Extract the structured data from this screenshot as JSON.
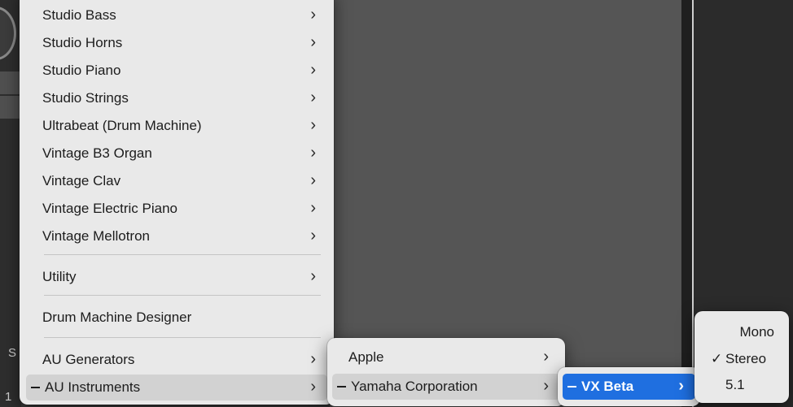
{
  "main_menu": {
    "items": [
      {
        "label": "Studio Bass",
        "submenu": true
      },
      {
        "label": "Studio Horns",
        "submenu": true
      },
      {
        "label": "Studio Piano",
        "submenu": true
      },
      {
        "label": "Studio Strings",
        "submenu": true
      },
      {
        "label": "Ultrabeat (Drum Machine)",
        "submenu": true
      },
      {
        "label": "Vintage B3 Organ",
        "submenu": true
      },
      {
        "label": "Vintage Clav",
        "submenu": true
      },
      {
        "label": "Vintage Electric Piano",
        "submenu": true
      },
      {
        "label": "Vintage Mellotron",
        "submenu": true
      }
    ],
    "utility": "Utility",
    "drum_machine_designer": "Drum Machine Designer",
    "au_generators": "AU Generators",
    "au_instruments": "AU Instruments"
  },
  "manufacturer_menu": {
    "apple": "Apple",
    "yamaha": "Yamaha Corporation"
  },
  "plugin_menu": {
    "vx_beta": "VX Beta"
  },
  "format_menu": {
    "mono": "Mono",
    "stereo": "Stereo",
    "surround": "5.1",
    "checkmark": "✓"
  },
  "background": {
    "track_letter": "S",
    "track_number": "1"
  },
  "chevron": "›"
}
